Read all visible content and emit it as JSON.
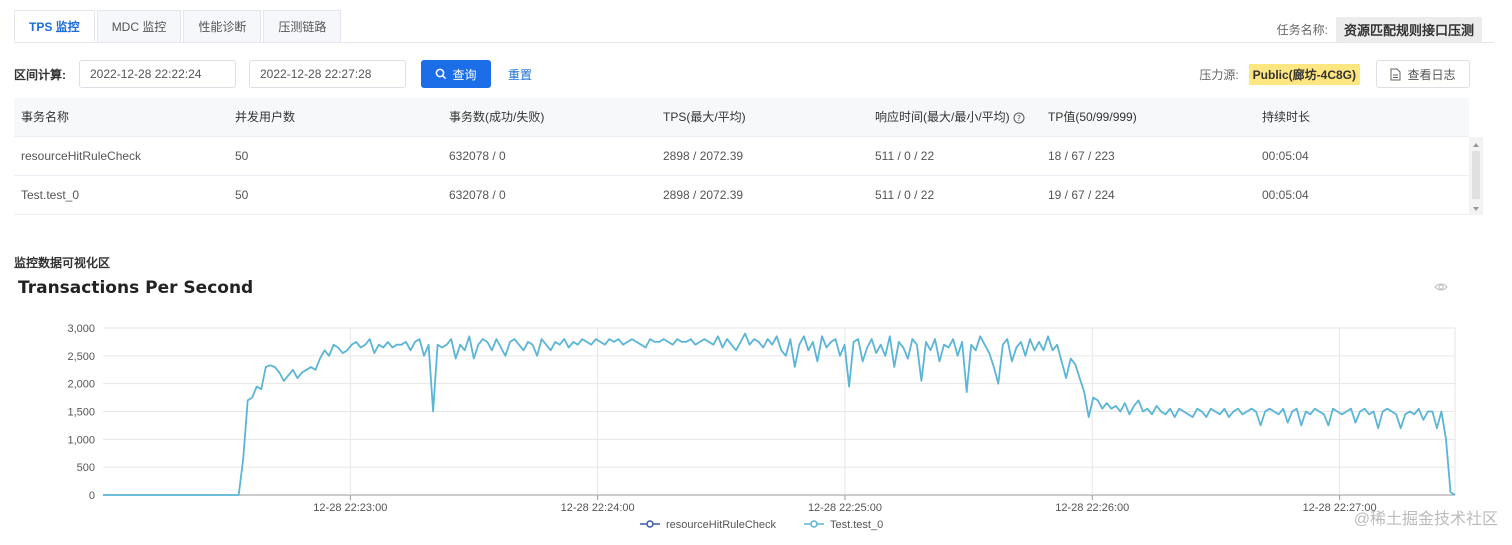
{
  "tabs": [
    {
      "label": "TPS 监控",
      "active": true
    },
    {
      "label": "MDC 监控",
      "active": false
    },
    {
      "label": "性能诊断",
      "active": false
    },
    {
      "label": "压测链路",
      "active": false
    }
  ],
  "task": {
    "label": "任务名称:",
    "value": "资源匹配规则接口压测"
  },
  "toolbar": {
    "range_label": "区间计算:",
    "start_time": "2022-12-28 22:22:24",
    "end_time": "2022-12-28 22:27:28",
    "query_label": "查询",
    "reset_label": "重置"
  },
  "pressure": {
    "label": "压力源:",
    "value": "Public(廊坊-4C8G)",
    "log_button": "查看日志"
  },
  "table": {
    "headers": [
      "事务名称",
      "并发用户数",
      "事务数(成功/失败)",
      "TPS(最大/平均)",
      "响应时间(最大/最小/平均)",
      "TP值(50/99/999)",
      "持续时长"
    ],
    "rows": [
      [
        "resourceHitRuleCheck",
        "50",
        "632078 / 0",
        "2898 / 2072.39",
        "511 / 0 / 22",
        "18 / 67 / 223",
        "00:05:04"
      ],
      [
        "Test.test_0",
        "50",
        "632078 / 0",
        "2898 / 2072.39",
        "511 / 0 / 22",
        "19 / 67 / 224",
        "00:05:04"
      ]
    ]
  },
  "section_title": "监控数据可视化区",
  "watermark": "@稀土掘金技术社区",
  "colors": {
    "accent": "#1b6ee8",
    "series_line": "#5ab5d6",
    "legend_a": "#3b5aa8"
  },
  "chart_data": {
    "type": "line",
    "title": "Transactions Per Second",
    "ylim": [
      0,
      3000
    ],
    "y_ticks": [
      "0",
      "500",
      "1,000",
      "1,500",
      "2,000",
      "2,500",
      "3,000"
    ],
    "x_ticks": [
      "12-28 22:23:00",
      "12-28 22:24:00",
      "12-28 22:25:00",
      "12-28 22:26:00",
      "12-28 22:27:00"
    ],
    "x_start": "12-28 22:22:00",
    "x_end": "12-28 22:27:28",
    "legend_position": "bottom-center",
    "grid": true,
    "series": [
      {
        "name": "resourceHitRuleCheck",
        "color": "#3b5aa8",
        "values": []
      },
      {
        "name": "Test.test_0",
        "color": "#5ab5d6",
        "values": [
          0,
          0,
          0,
          0,
          0,
          0,
          0,
          0,
          0,
          0,
          0,
          0,
          0,
          0,
          0,
          0,
          0,
          0,
          0,
          0,
          0,
          0,
          0,
          0,
          0,
          0,
          0,
          0,
          0,
          0,
          0,
          650,
          1700,
          1750,
          1950,
          1900,
          2300,
          2330,
          2300,
          2200,
          2050,
          2150,
          2250,
          2100,
          2200,
          2250,
          2300,
          2250,
          2450,
          2600,
          2500,
          2700,
          2650,
          2550,
          2600,
          2700,
          2750,
          2650,
          2700,
          2800,
          2550,
          2700,
          2650,
          2750,
          2650,
          2700,
          2700,
          2750,
          2600,
          2750,
          2800,
          2500,
          2700,
          1500,
          2700,
          2650,
          2700,
          2800,
          2450,
          2700,
          2600,
          2850,
          2450,
          2700,
          2800,
          2750,
          2600,
          2800,
          2650,
          2500,
          2750,
          2800,
          2700,
          2600,
          2750,
          2700,
          2500,
          2800,
          2700,
          2600,
          2750,
          2700,
          2800,
          2650,
          2750,
          2700,
          2800,
          2750,
          2700,
          2800,
          2750,
          2700,
          2800,
          2750,
          2800,
          2700,
          2750,
          2800,
          2750,
          2700,
          2650,
          2800,
          2750,
          2750,
          2800,
          2750,
          2700,
          2800,
          2750,
          2750,
          2800,
          2700,
          2750,
          2800,
          2750,
          2700,
          2850,
          2650,
          2800,
          2700,
          2600,
          2750,
          2900,
          2700,
          2800,
          2750,
          2650,
          2800,
          2700,
          2850,
          2600,
          2500,
          2800,
          2300,
          2700,
          2850,
          2600,
          2750,
          2400,
          2850,
          2650,
          2750,
          2800,
          2500,
          2700,
          1950,
          2750,
          2800,
          2400,
          2650,
          2800,
          2550,
          2700,
          2500,
          2850,
          2300,
          2750,
          2650,
          2450,
          2800,
          2700,
          2050,
          2750,
          2600,
          2800,
          2400,
          2700,
          2650,
          2800,
          2500,
          2750,
          1850,
          2700,
          2600,
          2850,
          2700,
          2550,
          2300,
          2000,
          2700,
          2800,
          2400,
          2650,
          2750,
          2500,
          2800,
          2600,
          2750,
          2600,
          2850,
          2600,
          2700,
          2400,
          2100,
          2450,
          2350,
          2100,
          1850,
          1400,
          1750,
          1700,
          1550,
          1650,
          1550,
          1600,
          1500,
          1650,
          1450,
          1600,
          1700,
          1500,
          1550,
          1450,
          1600,
          1500,
          1450,
          1550,
          1400,
          1550,
          1500,
          1450,
          1400,
          1550,
          1500,
          1400,
          1550,
          1500,
          1450,
          1550,
          1400,
          1500,
          1550,
          1450,
          1500,
          1550,
          1500,
          1250,
          1500,
          1550,
          1500,
          1450,
          1550,
          1300,
          1500,
          1550,
          1250,
          1500,
          1450,
          1550,
          1500,
          1450,
          1250,
          1550,
          1500,
          1450,
          1500,
          1550,
          1300,
          1500,
          1550,
          1450,
          1500,
          1200,
          1500,
          1550,
          1500,
          1450,
          1200,
          1450,
          1500,
          1450,
          1550,
          1350,
          1500,
          1500,
          1200,
          1500,
          1000,
          50,
          0
        ]
      }
    ]
  }
}
